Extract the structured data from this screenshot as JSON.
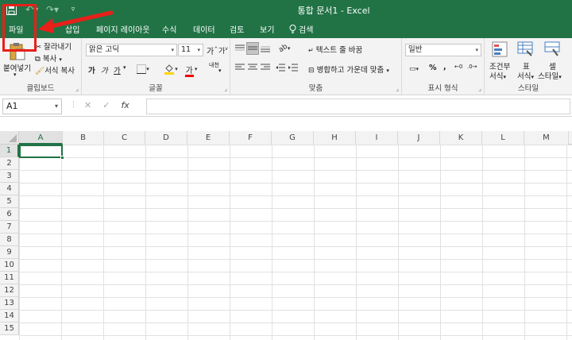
{
  "window": {
    "title": "통합 문서1  -  Excel"
  },
  "qat": {
    "save_icon": "save-icon",
    "undo_icon": "undo-icon",
    "redo_icon": "redo-icon",
    "customize_icon": "customize-icon"
  },
  "tabs": [
    {
      "label": "파일"
    },
    {
      "label": "삽입"
    },
    {
      "label": "페이지 레이아웃"
    },
    {
      "label": "수식"
    },
    {
      "label": "데이터"
    },
    {
      "label": "검토"
    },
    {
      "label": "보기"
    },
    {
      "label": "검색"
    }
  ],
  "clipboard": {
    "paste_label": "붙여넣기",
    "cut_label": "잘라내기",
    "copy_label": "복사",
    "format_painter_label": "서식 복사",
    "group_label": "클립보드"
  },
  "font": {
    "font_name": "맑은 고딕",
    "font_size": "11",
    "bold": "가",
    "italic": "가",
    "underline": "가",
    "font_color_glyph": "가",
    "grow_font": "가",
    "shrink_font": "가",
    "phonetic": "내천",
    "group_label": "글꼴"
  },
  "alignment": {
    "wrap_text_label": "텍스트 줄 바꿈",
    "merge_center_label": "병합하고 가운데 맞춤",
    "group_label": "맞춤"
  },
  "number": {
    "format": "일반",
    "percent": "%",
    "comma": ",",
    "group_label": "표시 형식"
  },
  "styles": {
    "conditional_label_1": "조건부",
    "conditional_label_2": "서식",
    "table_label_1": "표",
    "table_label_2": "서식",
    "cell_styles_label_1": "셀",
    "cell_styles_label_2": "스타일",
    "group_label": "스타일"
  },
  "formula_bar": {
    "name_box": "A1",
    "cancel": "✕",
    "enter": "✓",
    "fx": "fx"
  },
  "columns": [
    "A",
    "B",
    "C",
    "D",
    "E",
    "F",
    "G",
    "H",
    "I",
    "J",
    "K",
    "L",
    "M"
  ],
  "rows": [
    "1",
    "2",
    "3",
    "4",
    "5",
    "6",
    "7",
    "8",
    "9",
    "10",
    "11",
    "12",
    "13",
    "14",
    "15"
  ],
  "colors": {
    "accent": "#217346",
    "annotation": "#e8201a"
  }
}
